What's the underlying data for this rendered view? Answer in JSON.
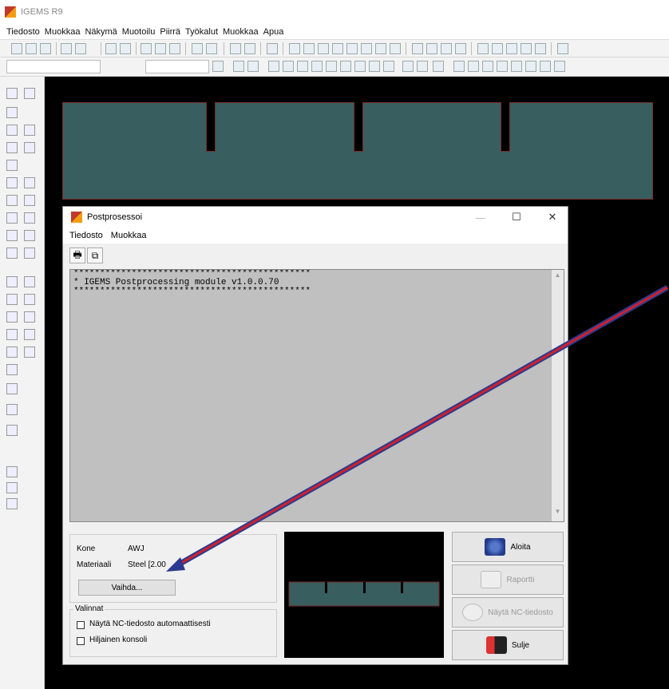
{
  "app": {
    "title": "IGEMS R9"
  },
  "menu": [
    "Tiedosto",
    "Muokkaa",
    "Näkymä",
    "Muotoilu",
    "Piirrä",
    "Työkalut",
    "Muokkaa",
    "Apua"
  ],
  "dialog": {
    "title": "Postprosessoi",
    "menu": [
      "Tiedosto",
      "Muokkaa"
    ],
    "console_text": "*********************************************\n* IGEMS Postprocessing module v1.0.0.70\n*********************************************",
    "machine_label": "Kone",
    "machine_value": "AWJ",
    "material_label": "Materiaali",
    "material_value": "Steel [2.00",
    "change_button": "Vaihda...",
    "options_title": "Valinnat",
    "option1": "Näytä NC-tiedosto automaattisesti",
    "option2": "Hiljainen konsoli",
    "start_button": "Aloita",
    "report_button": "Raportti",
    "show_nc_button": "Näytä NC-tiedosto",
    "close_button": "Sulje"
  },
  "colors": {
    "part_fill": "#385e5f",
    "part_edge": "#7a2a2a",
    "canvas": "#000000",
    "arrow": "#d0202a",
    "arrow_outline": "#2b3a8f"
  },
  "icons": [
    "print-icon",
    "copy-icon",
    "gear-start-icon",
    "report-icon",
    "show-nc-icon",
    "exit-door-icon",
    "minimize-icon",
    "maximize-icon",
    "close-icon"
  ]
}
